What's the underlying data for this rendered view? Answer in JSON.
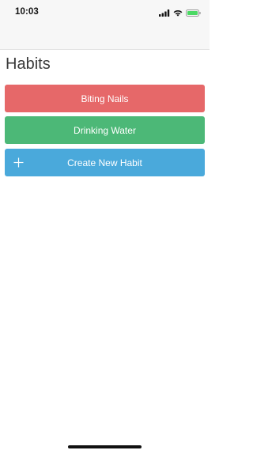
{
  "status_bar": {
    "time": "10:03",
    "icons": [
      "signal-icon",
      "wifi-icon",
      "battery-icon"
    ],
    "battery_color": "#4cd964"
  },
  "screen": {
    "title": "Habits"
  },
  "habits": [
    {
      "label": "Biting Nails",
      "color": "#e66869"
    },
    {
      "label": "Drinking Water",
      "color": "#4cb877"
    }
  ],
  "create_button": {
    "label": "Create New Habit",
    "icon": "plus-icon",
    "color": "#4aa9db"
  }
}
